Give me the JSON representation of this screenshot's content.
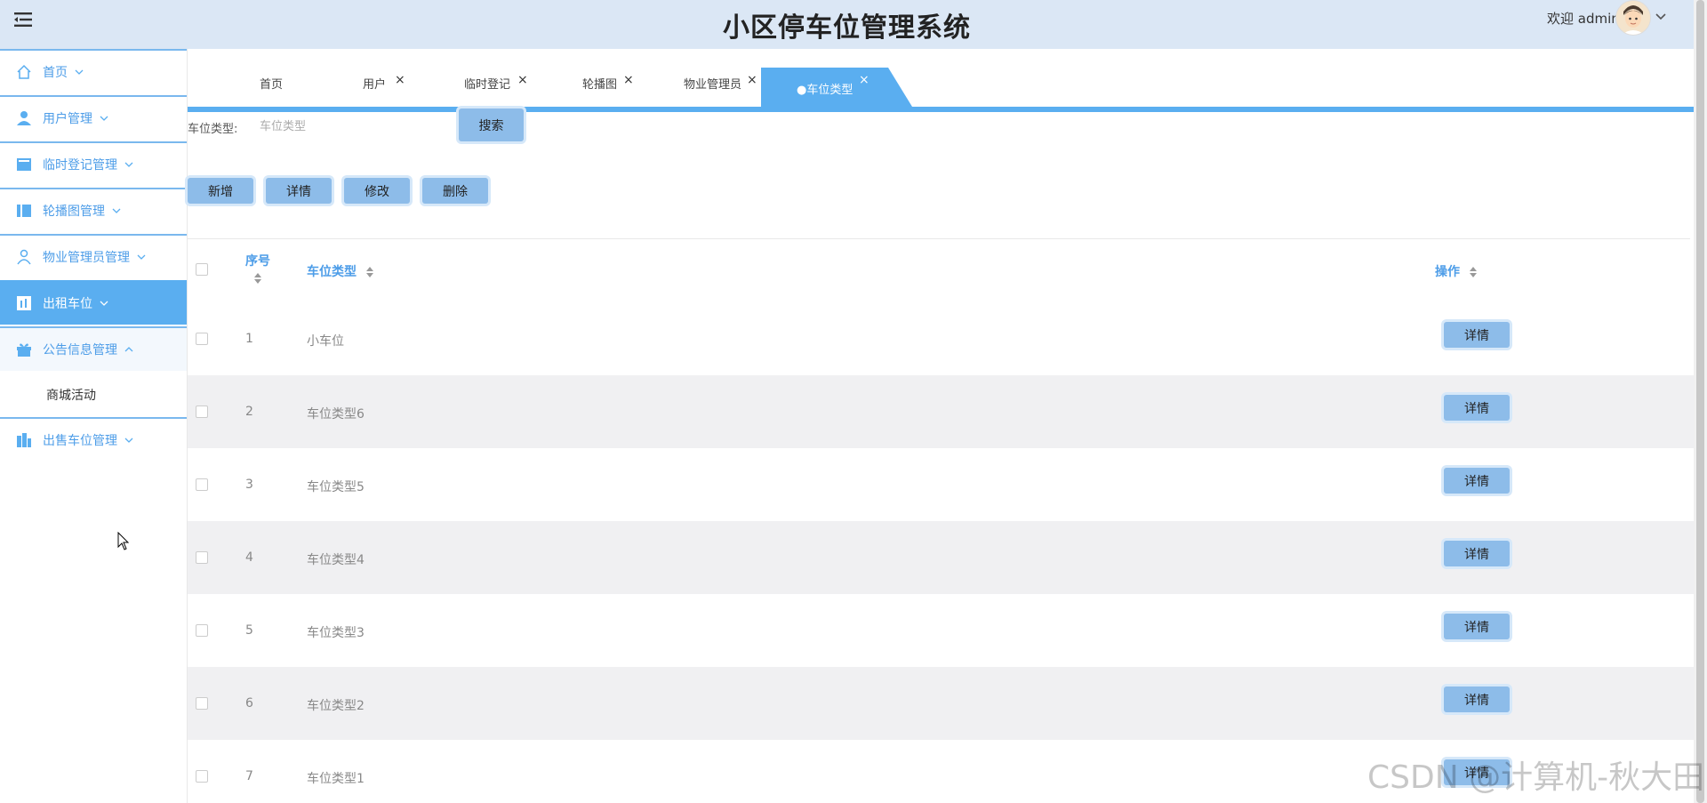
{
  "header": {
    "title": "小区停车位管理系统",
    "welcome": "欢迎 admin"
  },
  "sidebar": {
    "items": [
      {
        "label": "首页",
        "icon": "home-icon"
      },
      {
        "label": "用户管理",
        "icon": "user-icon"
      },
      {
        "label": "临时登记管理",
        "icon": "book-icon"
      },
      {
        "label": "轮播图管理",
        "icon": "columns-icon"
      },
      {
        "label": "物业管理员管理",
        "icon": "person-icon"
      },
      {
        "label": "出租车位",
        "icon": "chart-icon"
      },
      {
        "label": "公告信息管理",
        "icon": "gift-icon"
      },
      {
        "label": "出售车位管理",
        "icon": "building-icon"
      }
    ],
    "submenu": {
      "label": "商城活动"
    }
  },
  "tabs": [
    {
      "label": "首页"
    },
    {
      "label": "用户"
    },
    {
      "label": "临时登记"
    },
    {
      "label": "轮播图"
    },
    {
      "label": "物业管理员"
    },
    {
      "label": "车位类型"
    }
  ],
  "search": {
    "label": "车位类型:",
    "placeholder": "车位类型",
    "button": "搜索"
  },
  "actions": {
    "add": "新增",
    "detail": "详情",
    "edit": "修改",
    "delete": "删除"
  },
  "table": {
    "columns": {
      "index": "序号",
      "type": "车位类型",
      "op": "操作"
    },
    "row_button": "详情",
    "rows": [
      {
        "index": "1",
        "type": "小车位"
      },
      {
        "index": "2",
        "type": "车位类型6"
      },
      {
        "index": "3",
        "type": "车位类型5"
      },
      {
        "index": "4",
        "type": "车位类型4"
      },
      {
        "index": "5",
        "type": "车位类型3"
      },
      {
        "index": "6",
        "type": "车位类型2"
      },
      {
        "index": "7",
        "type": "车位类型1"
      }
    ]
  },
  "watermark": "CSDN @计算机-秋大田",
  "colors": {
    "accent": "#5aaef0",
    "header_bg": "#dbe7f5",
    "button_bg": "#8dbce9"
  }
}
